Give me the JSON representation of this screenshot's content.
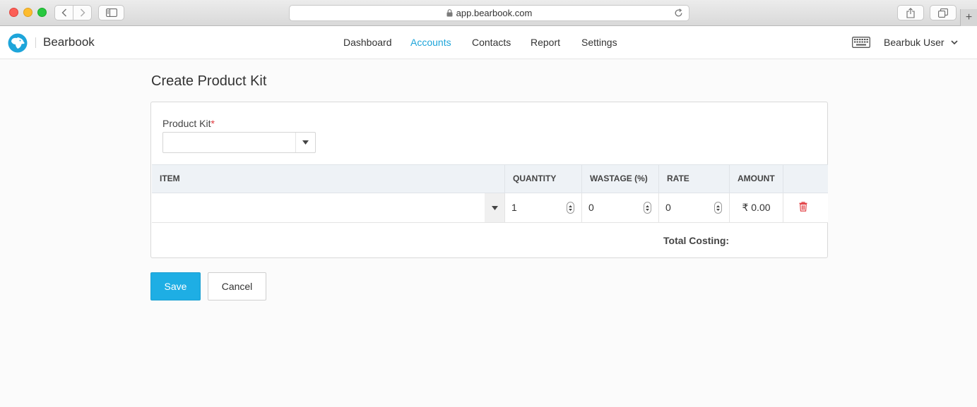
{
  "browser": {
    "url": "app.bearbook.com",
    "new_tab_label": "+"
  },
  "app": {
    "brand": "Bearbook",
    "nav": [
      {
        "label": "Dashboard",
        "active": false
      },
      {
        "label": "Accounts",
        "active": true
      },
      {
        "label": "Contacts",
        "active": false
      },
      {
        "label": "Report",
        "active": false
      },
      {
        "label": "Settings",
        "active": false
      }
    ],
    "user_name": "Bearbuk User"
  },
  "page": {
    "title": "Create Product Kit",
    "product_kit_label": "Product Kit",
    "required_mark": "*",
    "product_kit_value": "",
    "table": {
      "headers": [
        "ITEM",
        "QUANTITY",
        "WASTAGE (%)",
        "RATE",
        "AMOUNT"
      ],
      "rows": [
        {
          "item": "",
          "quantity": "1",
          "wastage": "0",
          "rate": "0",
          "amount": "₹ 0.00"
        }
      ]
    },
    "total_label": "Total Costing:",
    "save_label": "Save",
    "cancel_label": "Cancel"
  },
  "colors": {
    "accent": "#1eaee4",
    "active_nav": "#1ea5da",
    "delete": "#e0393e",
    "required": "#e0393e"
  }
}
